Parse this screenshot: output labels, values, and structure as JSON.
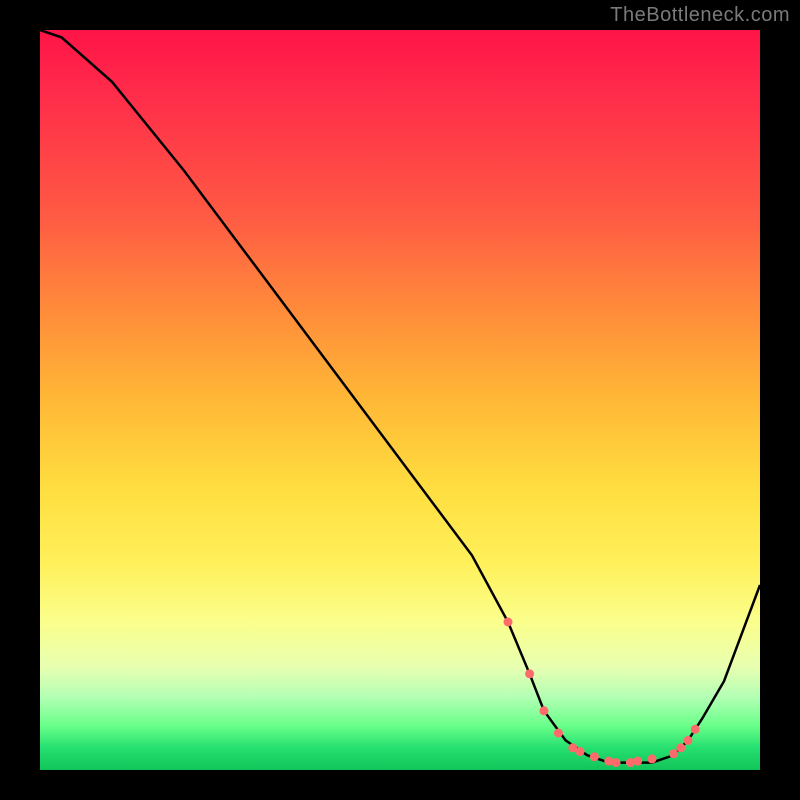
{
  "watermark": "TheBottleneck.com",
  "chart_data": {
    "type": "line",
    "title": "",
    "xlabel": "",
    "ylabel": "",
    "xlim": [
      0,
      100
    ],
    "ylim": [
      0,
      100
    ],
    "series": [
      {
        "name": "bottleneck-curve",
        "x": [
          0,
          3,
          10,
          20,
          30,
          40,
          50,
          60,
          65,
          68,
          70,
          73,
          76,
          79,
          82,
          85,
          88,
          90,
          92,
          95,
          100
        ],
        "y": [
          100,
          99,
          93,
          81,
          68,
          55,
          42,
          29,
          20,
          13,
          8,
          4,
          2,
          1,
          1,
          1,
          2,
          4,
          7,
          12,
          25
        ]
      }
    ],
    "scatter_points": {
      "name": "highlighted-points",
      "x": [
        65,
        68,
        70,
        72,
        74,
        75,
        77,
        79,
        80,
        82,
        83,
        85,
        88,
        89,
        90,
        91
      ],
      "y": [
        20,
        13,
        8,
        5,
        3,
        2.5,
        1.8,
        1.2,
        1,
        1,
        1.2,
        1.5,
        2.2,
        3,
        4,
        5.5
      ]
    },
    "gradient_meaning": "vertical heat gradient, red=high bottleneck, green=low bottleneck"
  }
}
